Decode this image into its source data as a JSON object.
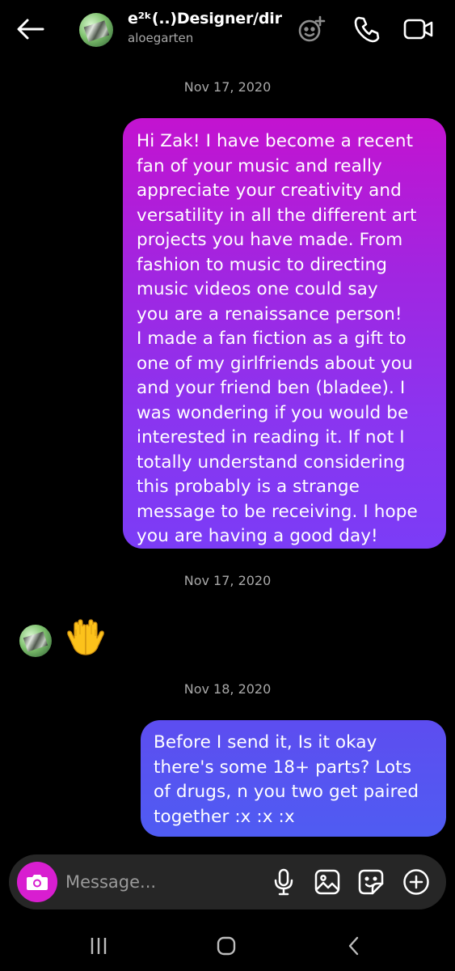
{
  "header": {
    "contact_name": "e²ᵏ(..)Designer/dir",
    "contact_handle": "aloegarten",
    "icons": [
      "back-arrow-icon",
      "video-effects-icon",
      "phone-icon",
      "video-camera-icon"
    ]
  },
  "thread": {
    "date_1": "Nov 17, 2020",
    "message_1_lines": [
      "Hi Zak! I have become a recent",
      "fan of your music and really",
      "appreciate your creativity and",
      "versatility in all the different art",
      "projects you have made. From",
      "fashion to music to directing",
      "music videos one could say",
      "you are a renaissance person!",
      "I made a fan fiction as a gift to",
      "one of my girlfriends about you",
      "and your friend ben (bladee). I",
      "was wondering if you would be",
      "interested in reading it. If not I",
      "totally understand considering",
      "this probably is a strange",
      "message to be receiving. I hope",
      "you are having a good day!"
    ],
    "date_2": "Nov 17, 2020",
    "reply_emoji": "palms-up-together",
    "date_3": "Nov 18, 2020",
    "message_2_lines": [
      "Before I send it, Is it okay",
      "there's some 18+ parts? Lots",
      "of drugs, n you two get paired",
      "together :x :x :x"
    ]
  },
  "composer": {
    "placeholder": "Message...",
    "icons": [
      "camera-icon",
      "microphone-icon",
      "gallery-icon",
      "sticker-icon",
      "add-icon"
    ]
  },
  "navbar": {
    "icons": [
      "recents-icon",
      "home-icon",
      "back-icon"
    ]
  },
  "colors": {
    "background": "#000000",
    "bubble_1_top": "#c313d0",
    "bubble_1_bottom": "#7b3cf6",
    "bubble_2": "#5457f1",
    "composer_bg": "#262626",
    "camera_button": "#d81ed0",
    "secondary_text": "#a8a8a8"
  }
}
